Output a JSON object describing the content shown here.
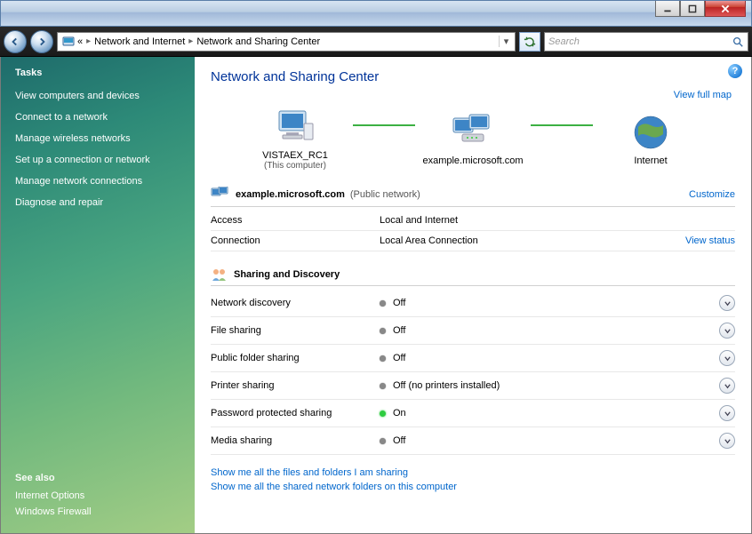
{
  "titlebar": {},
  "breadcrumb": {
    "root_glyph": "«",
    "part1": "Network and Internet",
    "part2": "Network and Sharing Center"
  },
  "search": {
    "placeholder": "Search"
  },
  "sidebar": {
    "tasks_heading": "Tasks",
    "tasks": [
      "View computers and devices",
      "Connect to a network",
      "Manage wireless networks",
      "Set up a connection or network",
      "Manage network connections",
      "Diagnose and repair"
    ],
    "see_also_heading": "See also",
    "see_also": [
      "Internet Options",
      "Windows Firewall"
    ]
  },
  "page": {
    "title": "Network and Sharing Center",
    "view_full_map": "View full map"
  },
  "map": {
    "node1": {
      "name": "VISTAEX_RC1",
      "sub": "(This computer)"
    },
    "node2": {
      "name": "example.microsoft.com"
    },
    "node3": {
      "name": "Internet"
    }
  },
  "network": {
    "name": "example.microsoft.com",
    "type_label": "(Public network)",
    "customize": "Customize",
    "access_label": "Access",
    "access_value": "Local and Internet",
    "connection_label": "Connection",
    "connection_value": "Local Area Connection",
    "view_status": "View status"
  },
  "sharing": {
    "heading": "Sharing and Discovery",
    "rows": [
      {
        "label": "Network discovery",
        "on": false,
        "value": "Off"
      },
      {
        "label": "File sharing",
        "on": false,
        "value": "Off"
      },
      {
        "label": "Public folder sharing",
        "on": false,
        "value": "Off"
      },
      {
        "label": "Printer sharing",
        "on": false,
        "value": "Off (no printers installed)"
      },
      {
        "label": "Password protected sharing",
        "on": true,
        "value": "On"
      },
      {
        "label": "Media sharing",
        "on": false,
        "value": "Off"
      }
    ]
  },
  "bottom_links": {
    "l1": "Show me all the files and folders I am sharing",
    "l2": "Show me all the shared network folders on this computer"
  }
}
